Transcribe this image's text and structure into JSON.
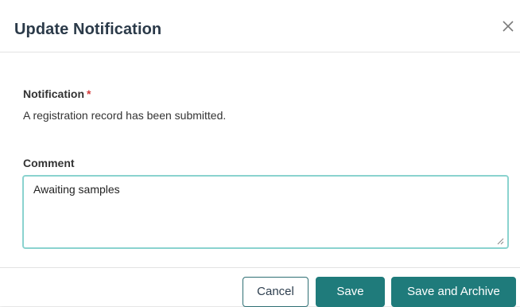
{
  "dialog": {
    "title": "Update Notification",
    "close_icon": "close-icon"
  },
  "notification": {
    "label": "Notification",
    "required_marker": "*",
    "text": "A registration record has been submitted."
  },
  "comment": {
    "label": "Comment",
    "value": "Awaiting samples"
  },
  "footer": {
    "cancel_label": "Cancel",
    "save_label": "Save",
    "save_archive_label": "Save and Archive"
  },
  "colors": {
    "primary_button": "#1f7b7b",
    "focus_border": "#8ad3cf",
    "required": "#d33b3b",
    "title": "#2b3a49"
  }
}
